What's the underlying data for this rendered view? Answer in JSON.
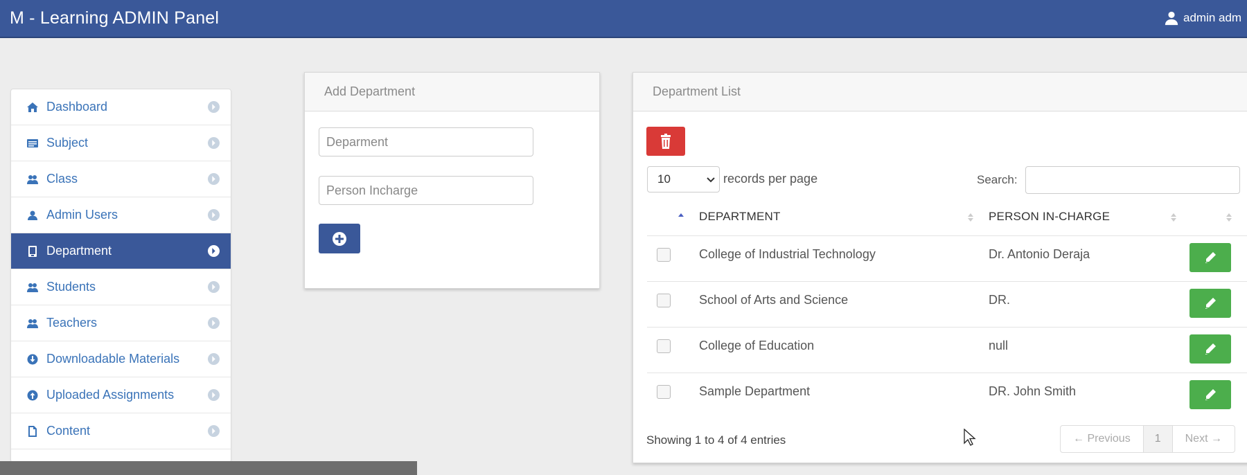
{
  "header": {
    "title": "M - Learning ADMIN Panel",
    "user_label": "admin adm"
  },
  "sidebar": {
    "items": [
      {
        "label": "Dashboard",
        "icon": "home-icon"
      },
      {
        "label": "Subject",
        "icon": "list-icon"
      },
      {
        "label": "Class",
        "icon": "users-icon"
      },
      {
        "label": "Admin Users",
        "icon": "user-icon"
      },
      {
        "label": "Department",
        "icon": "building-icon",
        "active": true
      },
      {
        "label": "Students",
        "icon": "users-icon"
      },
      {
        "label": "Teachers",
        "icon": "users-icon"
      },
      {
        "label": "Downloadable Materials",
        "icon": "download-icon"
      },
      {
        "label": "Uploaded Assignments",
        "icon": "upload-icon"
      },
      {
        "label": "Content",
        "icon": "file-icon"
      }
    ]
  },
  "add_department": {
    "title": "Add Department",
    "department_placeholder": "Deparment",
    "person_placeholder": "Person Incharge"
  },
  "department_list": {
    "title": "Department List",
    "records_per_page_value": "10",
    "records_per_page_label": "records per page",
    "search_label": "Search:",
    "columns": [
      "DEPARTMENT",
      "PERSON IN-CHARGE"
    ],
    "rows": [
      {
        "department": "College of Industrial Technology",
        "person": "Dr. Antonio Deraja"
      },
      {
        "department": "School of Arts and Science",
        "person": "DR."
      },
      {
        "department": "College of Education",
        "person": "null"
      },
      {
        "department": "Sample Department",
        "person": "DR. John Smith"
      }
    ],
    "info": "Showing 1 to 4 of 4 entries",
    "pagination": {
      "previous": "← Previous",
      "current": "1",
      "next": "Next →"
    }
  },
  "colors": {
    "primary": "#3a5899",
    "danger": "#d93a37",
    "success": "#4cae4c",
    "link": "#3a73b8"
  }
}
